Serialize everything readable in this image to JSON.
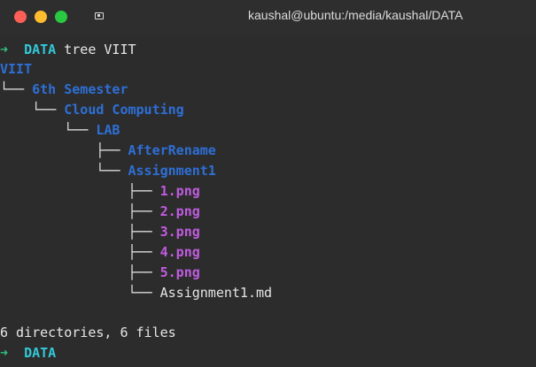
{
  "window": {
    "title": "kaushal@ubuntu:/media/kaushal/DATA"
  },
  "prompt": {
    "arrow": "➜",
    "dir": "DATA",
    "command": "tree VIIT"
  },
  "tree": [
    {
      "prefix": "",
      "name": "VIIT",
      "type": "dir"
    },
    {
      "prefix": "└── ",
      "name": "6th Semester",
      "type": "dir"
    },
    {
      "prefix": "    └── ",
      "name": "Cloud Computing",
      "type": "dir"
    },
    {
      "prefix": "        └── ",
      "name": "LAB",
      "type": "dir"
    },
    {
      "prefix": "            ├── ",
      "name": "AfterRename",
      "type": "dir"
    },
    {
      "prefix": "            └── ",
      "name": "Assignment1",
      "type": "dir"
    },
    {
      "prefix": "                ├── ",
      "name": "1.png",
      "type": "img"
    },
    {
      "prefix": "                ├── ",
      "name": "2.png",
      "type": "img"
    },
    {
      "prefix": "                ├── ",
      "name": "3.png",
      "type": "img"
    },
    {
      "prefix": "                ├── ",
      "name": "4.png",
      "type": "img"
    },
    {
      "prefix": "                ├── ",
      "name": "5.png",
      "type": "img"
    },
    {
      "prefix": "                └── ",
      "name": "Assignment1.md",
      "type": "file"
    }
  ],
  "summary": "6 directories, 6 files",
  "prompt2": {
    "arrow": "➜",
    "dir": "DATA"
  },
  "colors": {
    "prompt_arrow": "#2fc07e",
    "prompt_dir": "#32c8d6",
    "directory": "#2e6fd6",
    "image_file": "#c05ce0",
    "plain_file": "#e6e6e6",
    "background": "#2c2c2c"
  }
}
